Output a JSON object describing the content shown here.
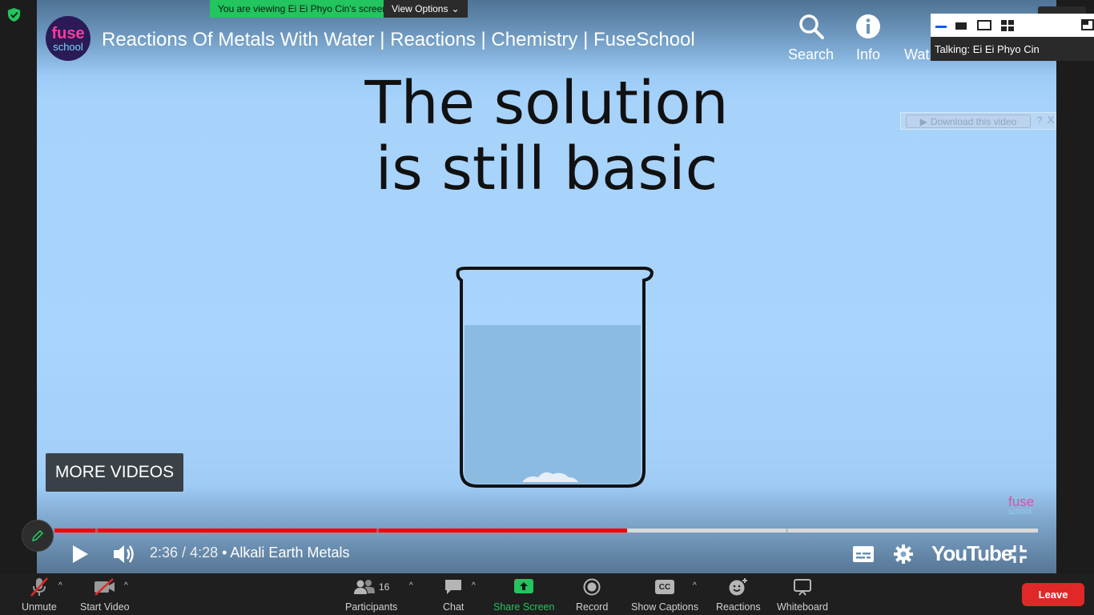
{
  "zoom": {
    "viewing_badge": "You are viewing Ei Ei Phyo Cin's screen",
    "view_options": "View Options",
    "talking": "Talking: Ei Ei Phyo Cin",
    "toolbar": {
      "unmute": "Unmute",
      "start_video": "Start Video",
      "participants_count": "16",
      "participants": "Participants",
      "chat": "Chat",
      "share_screen": "Share Screen",
      "record": "Record",
      "show_captions": "Show Captions",
      "cc_glyph": "CC",
      "reactions": "Reactions",
      "whiteboard": "Whiteboard",
      "leave": "Leave"
    },
    "colors": {
      "share_green": "#22c55e",
      "leave_red": "#e02828",
      "toolbar_bg": "#1f1f1f"
    }
  },
  "youtube": {
    "channel_logo_line1": "fuse",
    "channel_logo_line2": "school",
    "title": "Reactions Of Metals With Water | Reactions | Chemistry | FuseSchool",
    "top_buttons": {
      "search": "Search",
      "info": "Info",
      "watch_later_partial": "Wat"
    },
    "slide_line1": "The solution",
    "slide_line2": "is still basic",
    "more_videos": "MORE VIDEOS",
    "download": {
      "label": "Download this video",
      "help": "?",
      "close": "X"
    },
    "watermark_line1": "fuse",
    "watermark_line2": "school",
    "current_time": "2:36",
    "duration": "4:28",
    "time_separator": " / ",
    "chapter": " • Alkali Earth Metals",
    "logo_text": "YouTube",
    "progress_fraction": 0.582,
    "colors": {
      "played": "#ff0000",
      "unplayed": "#d9d9d9",
      "water": "#8bbbe0"
    }
  }
}
